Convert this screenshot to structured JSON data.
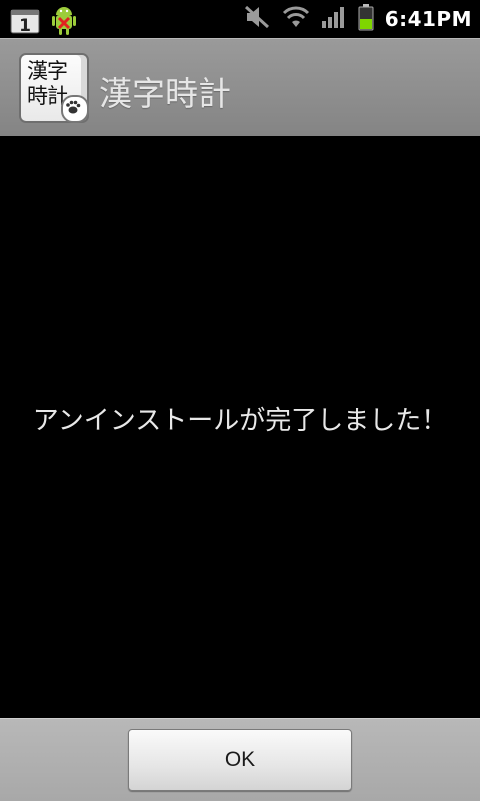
{
  "status_bar": {
    "notification_count": "1",
    "time": "6:41PM",
    "icons": [
      "calendar-icon",
      "android-error-icon",
      "mute-icon",
      "wifi-icon",
      "signal-icon",
      "battery-icon"
    ]
  },
  "title_bar": {
    "app_icon_text": [
      "漢字",
      "時計"
    ],
    "title": "漢字時計"
  },
  "main": {
    "message": "アンインストールが完了しました！"
  },
  "bottom_bar": {
    "ok_label": "OK"
  },
  "colors": {
    "background": "#000000",
    "title_bar": "#8e8e8e",
    "bottom_bar": "#b0b0b0",
    "battery_fill": "#7fd600"
  }
}
